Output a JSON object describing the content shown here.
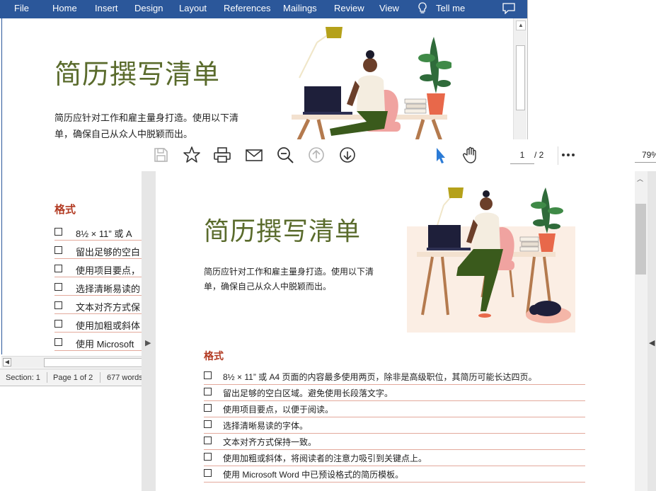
{
  "word": {
    "menu": [
      "File",
      "Home",
      "Insert",
      "Design",
      "Layout",
      "References",
      "Mailings",
      "Review",
      "View",
      "Tell me"
    ],
    "doc": {
      "title": "简历撰写清单",
      "intro_line1": "简历应针对工作和雇主量身打造。使用以下清",
      "intro_line2": "单，确保自己从众人中脱颖而出。",
      "heading": "格式",
      "items": [
        "8½ × 11” 或 A",
        "留出足够的空白",
        "使用项目要点，",
        "选择清晰易读的",
        "文本对齐方式保",
        "使用加粗或斜体",
        "使用 Microsoft"
      ]
    },
    "status": {
      "section": "Section: 1",
      "page": "Page 1 of 2",
      "words": "677 words"
    }
  },
  "pdf": {
    "toolbar": {
      "page_current": "1",
      "page_total": "/ 2",
      "zoom": "79%"
    },
    "doc": {
      "title": "简历撰写清单",
      "intro_line1": "简历应针对工作和雇主量身打造。使用以下清",
      "intro_line2": "单，确保自己从众人中脱颖而出。",
      "heading": "格式",
      "items": [
        "8½ × 11” 或 A4 页面的内容最多使用两页，除非是高级职位，其简历可能长达四页。",
        "留出足够的空白区域。避免使用长段落文字。",
        "使用项目要点，以便于阅读。",
        "选择清晰易读的字体。",
        "文本对齐方式保持一致。",
        "使用加粗或斜体，将阅读者的注意力吸引到关键点上。",
        "使用 Microsoft Word 中已预设格式的简历模板。"
      ]
    }
  },
  "colors": {
    "ribbon": "#2b579a",
    "title": "#5a6b2c",
    "heading": "#b23a22",
    "rule": "#e3a99c"
  }
}
